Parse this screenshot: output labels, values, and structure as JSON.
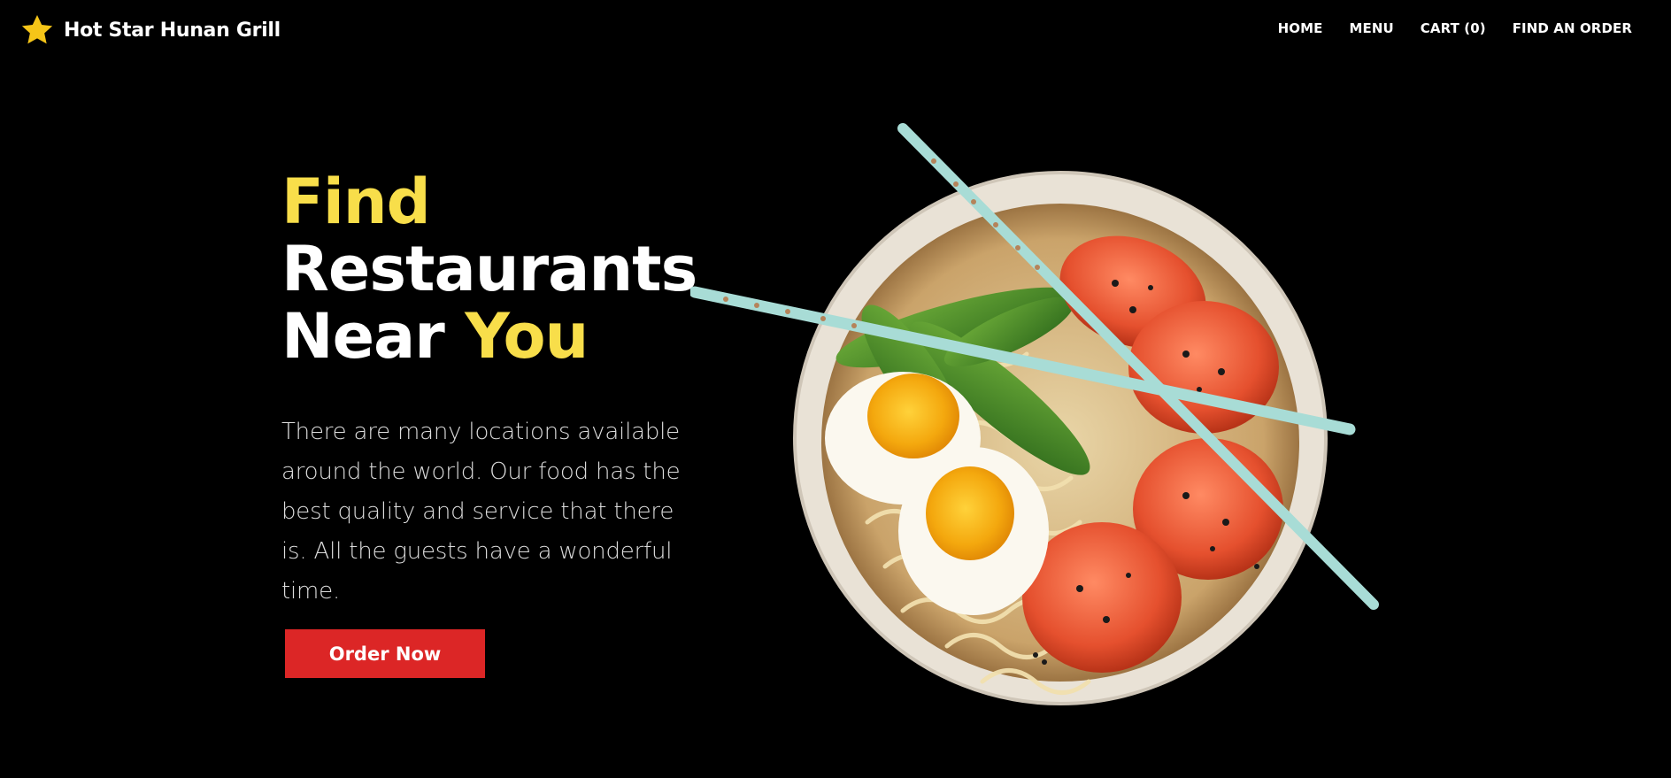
{
  "header": {
    "brand_name": "Hot Star Hunan Grill",
    "brand_icon": "star-icon",
    "nav": [
      {
        "label": "HOME"
      },
      {
        "label": "MENU"
      },
      {
        "label": "CART (0)"
      },
      {
        "label": "FIND AN ORDER"
      }
    ]
  },
  "hero": {
    "title_line1": "Find",
    "title_line2": "Restaurants",
    "title_line3_a": "Near",
    "title_line3_b": "You",
    "description": "There are many locations available around the world. Our food has the best quality and service that there is. All the guests have a wonderful time.",
    "cta_label": "Order Now"
  },
  "colors": {
    "background": "#000000",
    "accent_yellow": "#f8de4a",
    "cta_red": "#dc2626",
    "star": "#f5c518"
  },
  "image": {
    "description_icon": "ramen-bowl-image"
  }
}
